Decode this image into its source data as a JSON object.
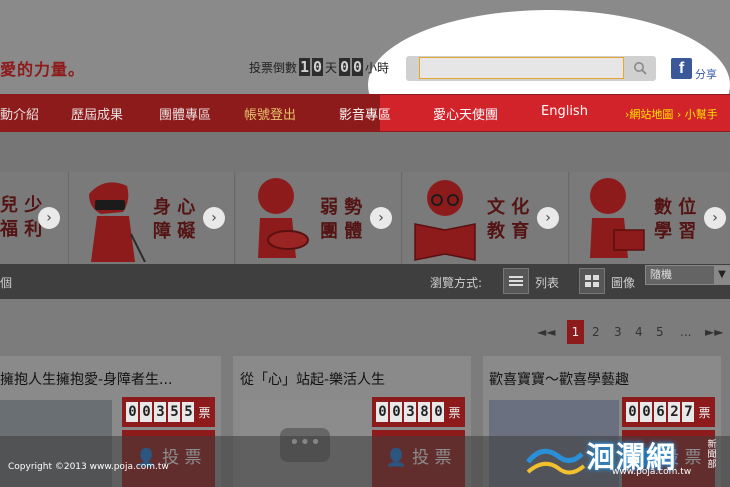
{
  "header": {
    "logo_text": "愛的力量。",
    "countdown_label": "投票倒數",
    "days_digits": [
      "1",
      "0"
    ],
    "days_unit": "天",
    "hours_digits": [
      "0",
      "0"
    ],
    "hours_unit": "小時",
    "search_placeholder": "",
    "share_label": "分享"
  },
  "nav": {
    "items": [
      "動介紹",
      "歷屆成果",
      "團體專區",
      "帳號登出",
      "影音專區",
      "愛心天使團",
      "English"
    ],
    "right_links": "›網站地圖 › 小幫手"
  },
  "categories": [
    {
      "line1": "兒 少",
      "line2": "福 利"
    },
    {
      "line1": "身 心",
      "line2": "障 礙"
    },
    {
      "line1": "弱 勢",
      "line2": "團 體"
    },
    {
      "line1": "文 化",
      "line2": "教 育"
    },
    {
      "line1": "數 位",
      "line2": "學 習"
    }
  ],
  "toolbar": {
    "left_text": "個",
    "browse_label": "瀏覽方式:",
    "list_label": "列表",
    "grid_label": "圖像",
    "sort_value": "隨機"
  },
  "pagination": {
    "prev": "◄◄",
    "pages": [
      "1",
      "2",
      "3",
      "4",
      "5"
    ],
    "ellipsis": "...",
    "next": "►►",
    "current": "1"
  },
  "posts": [
    {
      "title": "擁抱人生擁抱愛-身障者生...",
      "votes": [
        "0",
        "0",
        "3",
        "5",
        "5"
      ],
      "vote_unit": "票",
      "vote_button": "投 票"
    },
    {
      "title": "從「心」站起-樂活人生",
      "votes": [
        "0",
        "0",
        "3",
        "8",
        "0"
      ],
      "vote_unit": "票",
      "vote_button": "投 票"
    },
    {
      "title": "歡喜寶寶～歡喜學藝趣",
      "votes": [
        "0",
        "0",
        "6",
        "2",
        "7"
      ],
      "vote_unit": "票",
      "vote_button": "投 票"
    }
  ],
  "footer": {
    "copyright": "Copyright ©2013 www.poja.com.tw",
    "brand": "洄瀾網",
    "brand_url": "www.poja.com.tw",
    "brand_side": "新聞部"
  },
  "colors": {
    "nav_red": "#8e1b1b",
    "bright_red": "#d2232a",
    "search_border": "#e8a52b",
    "facebook": "#3b5998",
    "brand_glow": "#2a8fd6"
  }
}
